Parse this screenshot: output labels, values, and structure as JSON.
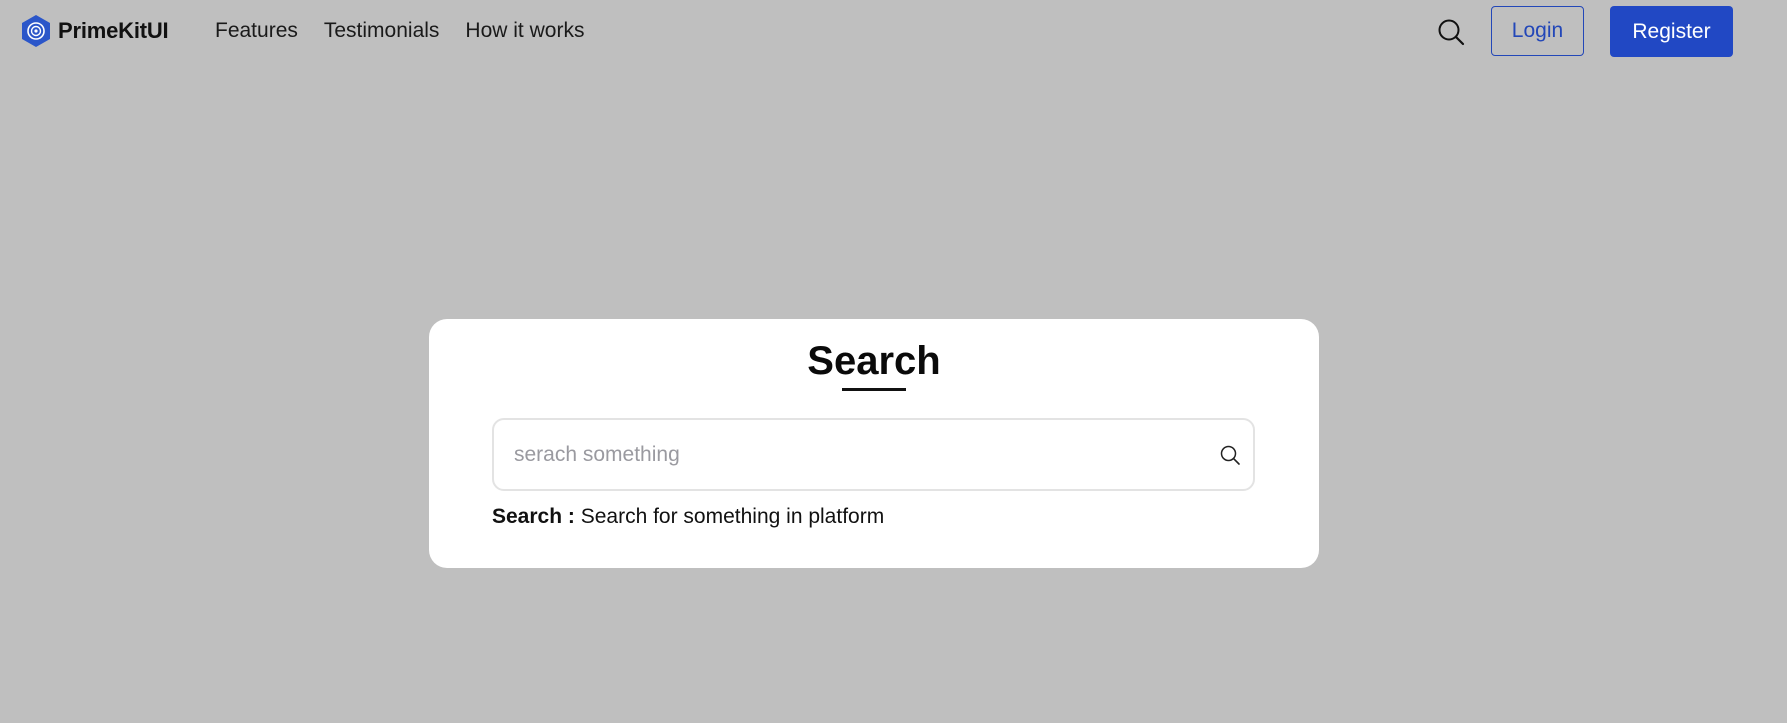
{
  "header": {
    "brand_name": "PrimeKitUI",
    "brand_icon": "hexagon-logo-icon",
    "nav": [
      {
        "label": "Features"
      },
      {
        "label": "Testimonials"
      },
      {
        "label": "How it works"
      }
    ],
    "search_icon": "search-icon",
    "login_label": "Login",
    "register_label": "Register",
    "accent_color": "#2148c4"
  },
  "card": {
    "title": "Search",
    "input_placeholder": "serach something",
    "input_value": "",
    "input_icon": "search-icon",
    "help_label": "Search :",
    "help_text": "Search for something in platform"
  },
  "colors": {
    "page_background": "#bfbfbf",
    "card_background": "#ffffff",
    "brand_blue": "#2148c4"
  }
}
